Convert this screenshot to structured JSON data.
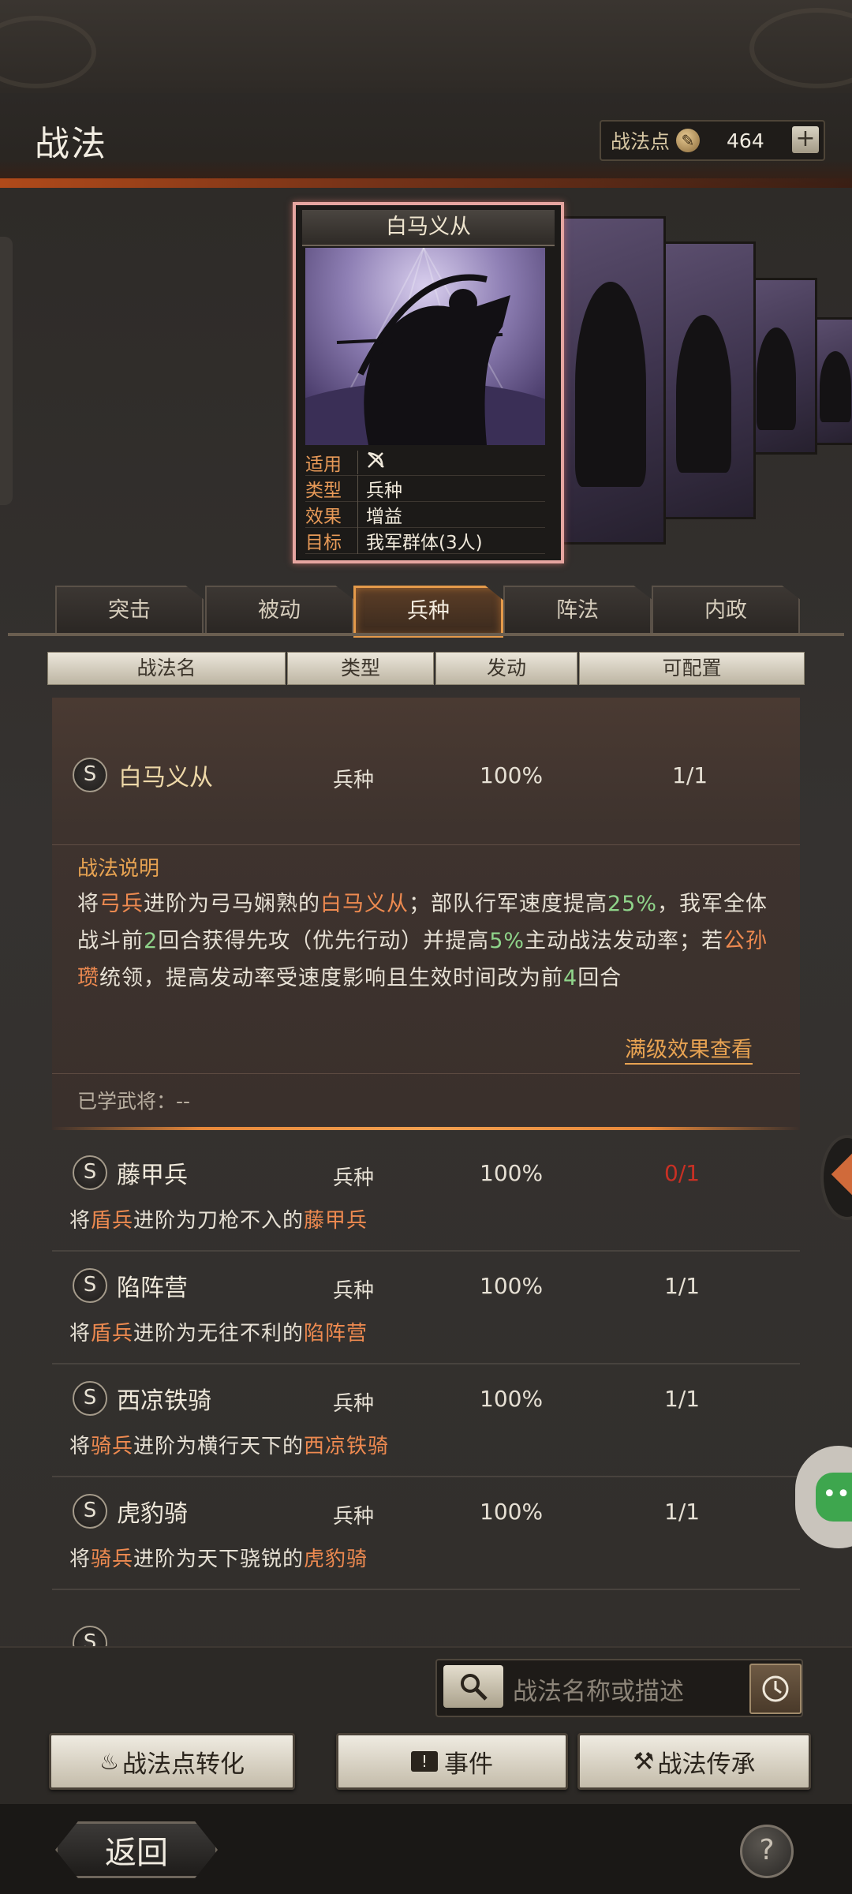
{
  "header": {
    "title": "战法",
    "points_label": "战法点",
    "points_value": "464",
    "plus_label": "+"
  },
  "card": {
    "name": "白马义从",
    "info": [
      {
        "key": "适用",
        "value": ""
      },
      {
        "key": "类型",
        "value": "兵种"
      },
      {
        "key": "效果",
        "value": "增益"
      },
      {
        "key": "目标",
        "value": "我军群体(3人)"
      }
    ]
  },
  "tabs": [
    "突击",
    "被动",
    "兵种",
    "阵法",
    "内政"
  ],
  "active_tab": "兵种",
  "columns": [
    "战法名",
    "类型",
    "发动",
    "可配置"
  ],
  "expanded": {
    "grade": "S",
    "name": "白马义从",
    "type": "兵种",
    "rate": "100%",
    "config": "1/1",
    "desc_title": "战法说明",
    "desc_parts": [
      [
        "将",
        "n"
      ],
      [
        "弓兵",
        "o"
      ],
      [
        "进阶为弓马娴熟的",
        "n"
      ],
      [
        "白马义从",
        "o"
      ],
      [
        "；部队行军速度提高",
        "n"
      ],
      [
        "25%",
        "g"
      ],
      [
        "，",
        "n"
      ],
      [
        "我军全体战斗前",
        "n"
      ],
      [
        "2",
        "g"
      ],
      [
        "回合获得先攻（优先行动）并提高",
        "n"
      ],
      [
        "5%",
        "g"
      ],
      [
        "主动战法发动率；若",
        "n"
      ],
      [
        "公孙瓒",
        "o"
      ],
      [
        "统领，提高发动率受速度影响且生效时间改为前",
        "n"
      ],
      [
        "4",
        "g"
      ],
      [
        "回合",
        "n"
      ]
    ],
    "more_link": "满级效果查看",
    "learned": "已学武将：--"
  },
  "rows": [
    {
      "grade": "S",
      "name": "藤甲兵",
      "type": "兵种",
      "rate": "100%",
      "config": "0/1",
      "config_red": true,
      "desc": [
        [
          "将",
          "n"
        ],
        [
          "盾兵",
          "o"
        ],
        [
          "进阶为刀枪不入的",
          "n"
        ],
        [
          "藤甲兵",
          "o"
        ]
      ]
    },
    {
      "grade": "S",
      "name": "陷阵营",
      "type": "兵种",
      "rate": "100%",
      "config": "1/1",
      "config_red": false,
      "desc": [
        [
          "将",
          "n"
        ],
        [
          "盾兵",
          "o"
        ],
        [
          "进阶为无往不利的",
          "n"
        ],
        [
          "陷阵营",
          "o"
        ]
      ]
    },
    {
      "grade": "S",
      "name": "西凉铁骑",
      "type": "兵种",
      "rate": "100%",
      "config": "1/1",
      "config_red": false,
      "desc": [
        [
          "将",
          "n"
        ],
        [
          "骑兵",
          "o"
        ],
        [
          "进阶为横行天下的",
          "n"
        ],
        [
          "西凉铁骑",
          "o"
        ]
      ]
    },
    {
      "grade": "S",
      "name": "虎豹骑",
      "type": "兵种",
      "rate": "100%",
      "config": "1/1",
      "config_red": false,
      "desc": [
        [
          "将",
          "n"
        ],
        [
          "骑兵",
          "o"
        ],
        [
          "进阶为天下骁锐的",
          "n"
        ],
        [
          "虎豹骑",
          "o"
        ]
      ]
    }
  ],
  "search": {
    "placeholder": "战法名称或描述"
  },
  "actions": {
    "convert": "战法点转化",
    "event": "事件",
    "inherit": "战法传承"
  },
  "footer": {
    "back": "返回",
    "help": "?"
  },
  "colors": {
    "accent_orange": "#e8a352",
    "highlight_orange": "#ee8a50",
    "highlight_green": "#8fd48a",
    "red": "#c83024"
  }
}
